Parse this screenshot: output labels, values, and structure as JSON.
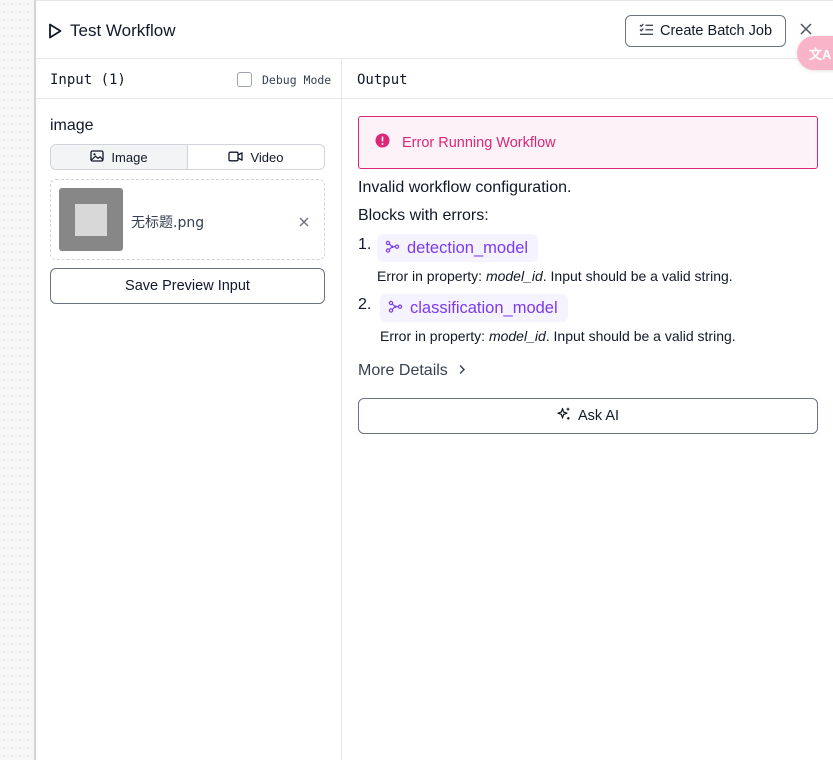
{
  "header": {
    "title": "Test Workflow",
    "create_batch_label": "Create Batch Job",
    "play_icon": "play-icon",
    "list_icon": "list-checks-icon",
    "close_icon": "close-icon"
  },
  "translate_fab": {
    "icon": "translate-icon",
    "glyph": "文A"
  },
  "input_panel": {
    "title": "Input (1)",
    "debug_mode_label": "Debug Mode",
    "debug_mode_checked": false,
    "field_label": "image",
    "tabs": [
      {
        "label": "Image",
        "icon": "image-icon",
        "active": true
      },
      {
        "label": "Video",
        "icon": "video-icon",
        "active": false
      }
    ],
    "file": {
      "name": "无标题.png"
    },
    "save_preview_label": "Save Preview Input"
  },
  "output_panel": {
    "title": "Output",
    "error_title": "Error Running Workflow",
    "message": "Invalid workflow configuration.",
    "blocks_title": "Blocks with errors:",
    "blocks": [
      {
        "number": "1.",
        "name": "detection_model",
        "detail_prefix": "Error in property: ",
        "property": "model_id",
        "detail_suffix": ". Input should be a valid string."
      },
      {
        "number": "2.",
        "name": "classification_model",
        "detail_prefix": "Error in property: ",
        "property": "model_id",
        "detail_suffix": ". Input should be a valid string."
      }
    ],
    "more_details_label": "More Details",
    "ask_ai_label": "Ask AI"
  },
  "colors": {
    "error": "#db2777",
    "error_bg": "#fdf2f8",
    "chip_text": "#7c3aed",
    "chip_bg": "#f5f3ff",
    "border": "#e5e7eb"
  }
}
